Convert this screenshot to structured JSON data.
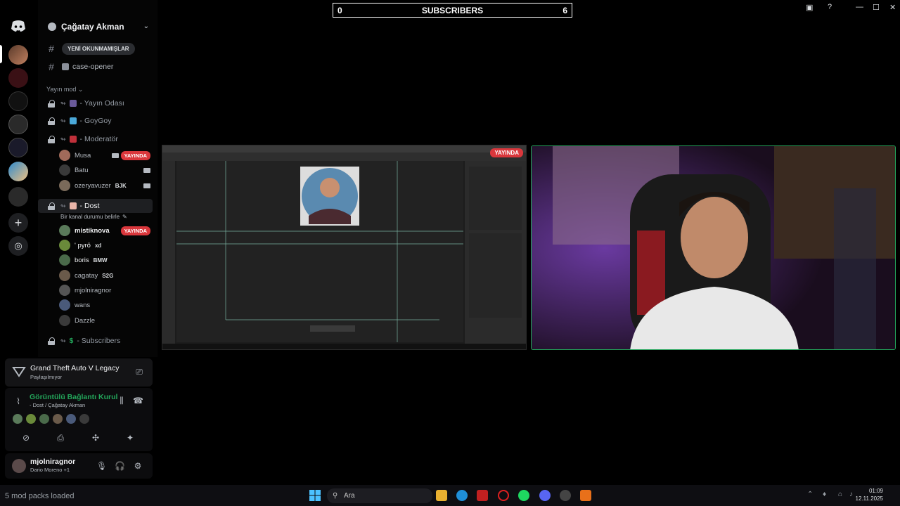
{
  "counter": {
    "left": "0",
    "label": "SUBSCRIBERS",
    "right": "6"
  },
  "server": {
    "name": "Çağatay Akman"
  },
  "channels": {
    "unread_pill": "YENİ OKUNMAMIŞLAR",
    "case_opener": "case-opener",
    "category": "Yayın mod",
    "voice": [
      {
        "name": "- Yayın Odası"
      },
      {
        "name": "- GoyGoy"
      },
      {
        "name": "- Moderatör"
      }
    ],
    "dost": {
      "name": "- Dost",
      "status_placeholder": "Bir kanal durumu belirle"
    },
    "subscribers": "- Subscribers"
  },
  "moderator_users": [
    {
      "name": "Musa",
      "live": "YAYINDA"
    },
    {
      "name": "Batu"
    },
    {
      "name": "ozeryavuzer",
      "tag": "BJK"
    }
  ],
  "dost_users": [
    {
      "name": "mistiknova",
      "live": "YAYINDA"
    },
    {
      "name": "' pyrö",
      "tag": "xd"
    },
    {
      "name": "boris",
      "tag": "BMW"
    },
    {
      "name": "cagatay",
      "tag": "S2G"
    },
    {
      "name": "mjolniragnor"
    },
    {
      "name": "wans"
    },
    {
      "name": "Dazzle"
    }
  ],
  "activity": {
    "game": "Grand Theft Auto V Legacy",
    "sub": "Paylaşılmıyor"
  },
  "voice_conn": {
    "title": "Görüntülü Bağlantı Kurul",
    "path": "- Dost / Çağatay Akman"
  },
  "me": {
    "name": "mjolniragnor",
    "status": "Dario Moreno +1"
  },
  "stream": {
    "live": "YAYINDA"
  },
  "taskbar": {
    "status": "5 mod packs loaded",
    "search": "Ara",
    "time": "01:09",
    "date": "12.11.2025"
  },
  "icons": [
    "discord-logo",
    "plus-icon",
    "compass-icon",
    "gear-icon",
    "mic-icon",
    "headphones-icon",
    "camera-icon",
    "screen-share-icon",
    "hangup-icon",
    "activity-icon",
    "soundboard-icon",
    "windows-icon",
    "search-icon",
    "help-icon",
    "inbox-icon"
  ]
}
